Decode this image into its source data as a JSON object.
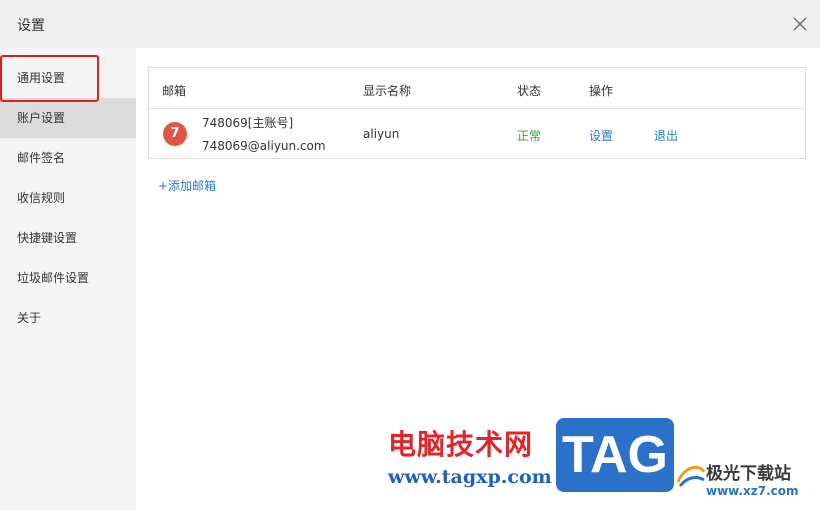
{
  "window": {
    "title": "设置"
  },
  "sidebar": {
    "items": [
      {
        "label": "通用设置"
      },
      {
        "label": "账户设置"
      },
      {
        "label": "邮件签名"
      },
      {
        "label": "收信规则"
      },
      {
        "label": "快捷键设置"
      },
      {
        "label": "垃圾邮件设置"
      },
      {
        "label": "关于"
      }
    ],
    "active_index": 1
  },
  "table": {
    "headers": {
      "mailbox": "邮箱",
      "display_name": "显示名称",
      "status": "状态",
      "actions": "操作"
    },
    "rows": [
      {
        "avatar": "7",
        "account_title": "748069[主账号]",
        "email": "748069@aliyun.com",
        "display_name": "aliyun",
        "status": "正常",
        "action_settings": "设置",
        "action_logout": "退出"
      }
    ]
  },
  "add_mailbox_label": "+添加邮箱",
  "watermark": {
    "site_name": "电脑技术网",
    "site_url": "www.tagxp.com",
    "badge": "TAG",
    "logo_name": "极光下载站",
    "logo_url": "www.xz7.com"
  },
  "colors": {
    "highlight": "#e02020",
    "link": "#2a7ad0",
    "status_ok": "#2aa52a",
    "avatar": "#e25443"
  }
}
